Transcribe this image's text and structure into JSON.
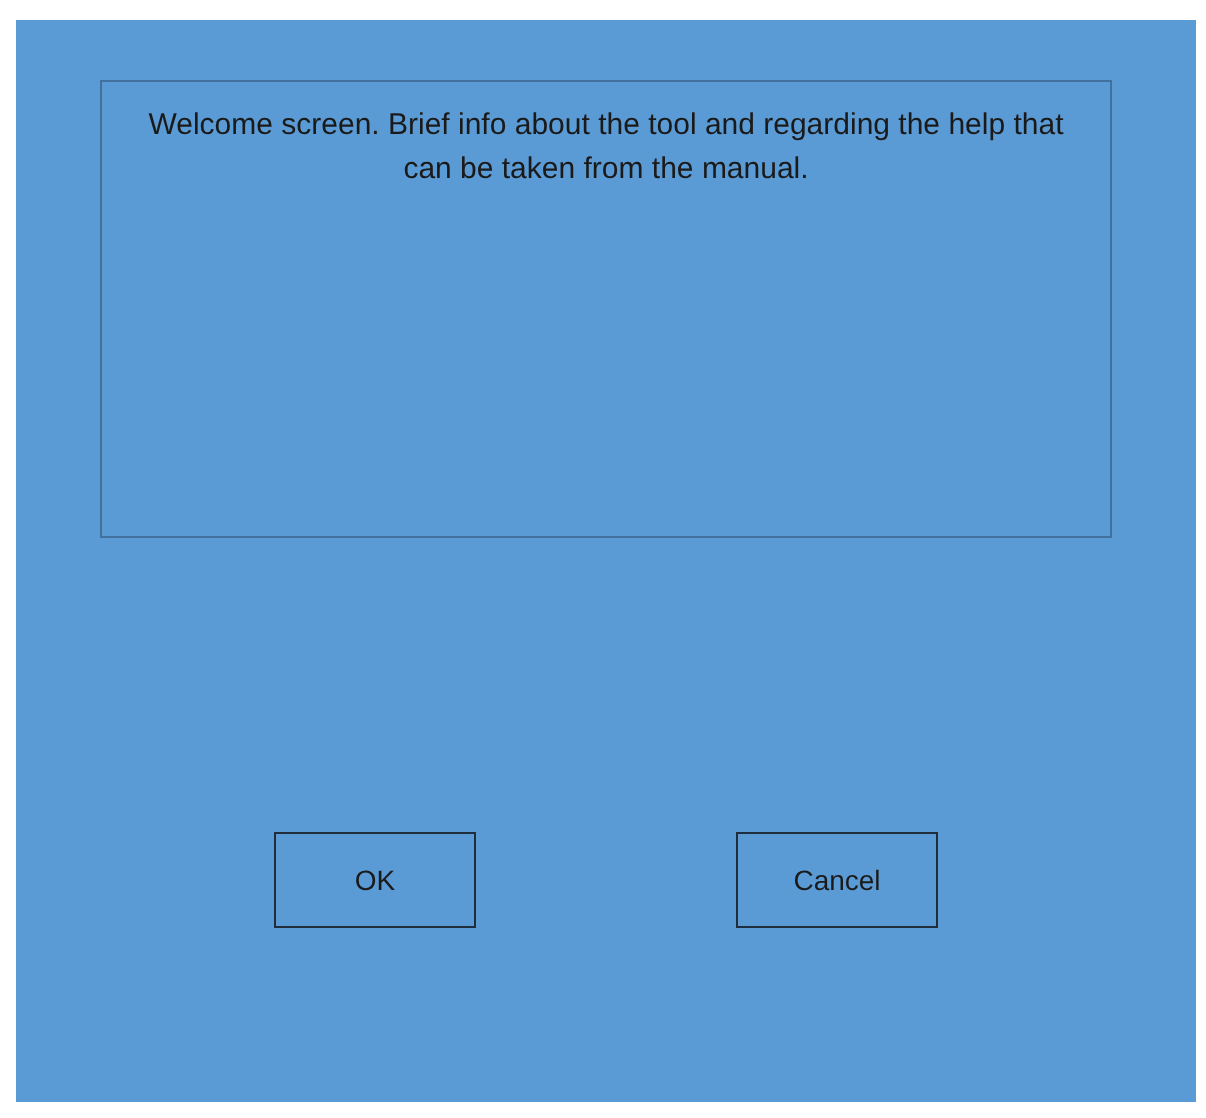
{
  "message": "Welcome screen. Brief info about the tool and regarding the help that can be taken from the manual.",
  "buttons": [
    {
      "label": "OK"
    },
    {
      "label": "Cancel"
    }
  ]
}
